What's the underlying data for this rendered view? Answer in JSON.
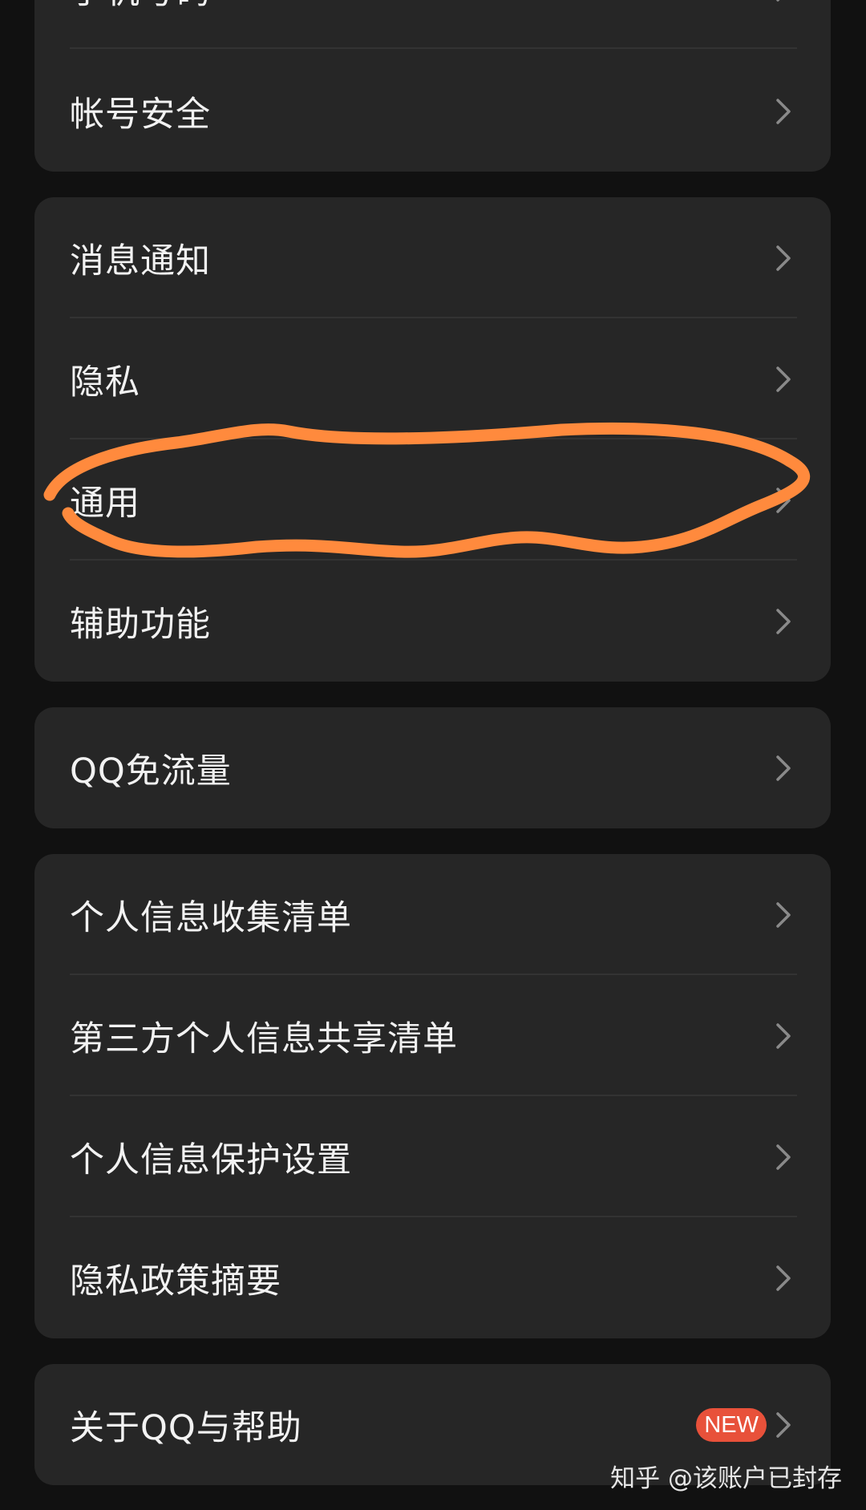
{
  "groups": [
    {
      "items": [
        {
          "label": "手机号码"
        },
        {
          "label": "帐号安全"
        }
      ]
    },
    {
      "items": [
        {
          "label": "消息通知"
        },
        {
          "label": "隐私"
        },
        {
          "label": "通用"
        },
        {
          "label": "辅助功能"
        }
      ]
    },
    {
      "items": [
        {
          "label": "QQ免流量"
        }
      ]
    },
    {
      "items": [
        {
          "label": "个人信息收集清单"
        },
        {
          "label": "第三方个人信息共享清单"
        },
        {
          "label": "个人信息保护设置"
        },
        {
          "label": "隐私政策摘要"
        }
      ]
    },
    {
      "items": [
        {
          "label": "关于QQ与帮助",
          "badge": "NEW"
        }
      ]
    }
  ],
  "icons": {
    "row_chevron": "chevron-right-icon"
  },
  "annotation": {
    "color": "#ff8a3d",
    "highlighted_item": "通用"
  },
  "watermark": "知乎 @该账户已封存",
  "colors": {
    "background": "#111111",
    "card": "#262626",
    "badge": "#e8513a"
  }
}
